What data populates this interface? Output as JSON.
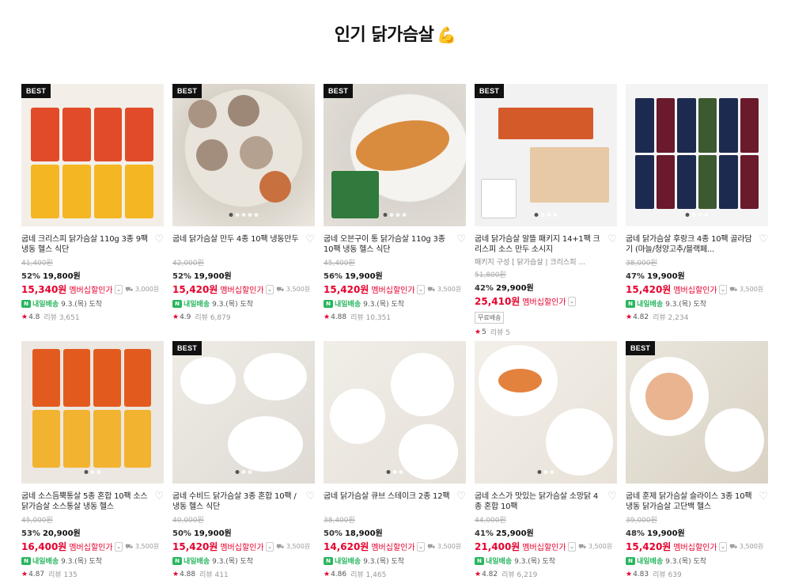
{
  "section": {
    "title": "인기 닭가슴살",
    "emoji": "💪"
  },
  "products": [
    {
      "best": true,
      "name": "굽네 크리스피 닭가슴살 110g 3종 9팩 냉동 헬스 식단",
      "orig": "41,400원",
      "pct": "52%",
      "price": "19,800원",
      "member_price": "15,340원",
      "member_label": "멤버십할인가",
      "ship": "3,000원",
      "delivery": "내일배송",
      "date": "9.3.(목) 도착",
      "rating": "4.8",
      "reviews": "리뷰 3,651",
      "dots": 0
    },
    {
      "best": true,
      "name": "굽네 닭가슴살 만두 4종 10팩 냉동만두",
      "orig": "42,000원",
      "pct": "52%",
      "price": "19,900원",
      "member_price": "15,420원",
      "member_label": "멤버십할인가",
      "ship": "3,500원",
      "delivery": "내일배송",
      "date": "9.3.(목) 도착",
      "rating": "4.9",
      "reviews": "리뷰 6,879",
      "dots": 5
    },
    {
      "best": true,
      "name": "굽네 오븐구이 통 닭가슴살 110g 3종 10팩 냉동 헬스 식단",
      "orig": "45,400원",
      "pct": "56%",
      "price": "19,900원",
      "member_price": "15,420원",
      "member_label": "멤버십할인가",
      "ship": "3,500원",
      "delivery": "내일배송",
      "date": "9.3.(목) 도착",
      "rating": "4.88",
      "reviews": "리뷰 10,351",
      "dots": 4
    },
    {
      "best": true,
      "name": "굽네 닭가슴살 알뜰 패키지 14+1팩 크리스피 소스 만두 소시지",
      "sub": "패키지 구성 [ 닭가슴살 | 크리스피 ...",
      "orig": "51,800원",
      "pct": "42%",
      "price": "29,900원",
      "member_price": "25,410원",
      "member_label": "멤버십할인가",
      "ship": "",
      "delivery": "",
      "date": "",
      "free": "무료배송",
      "rating": "5",
      "reviews": "리뷰 5",
      "dots": 4
    },
    {
      "best": false,
      "name": "굽네 닭가슴살 후랑크 4종 10팩 골라담기 (마늘/청양고추/블랙페...",
      "orig": "38,000원",
      "pct": "47%",
      "price": "19,900원",
      "member_price": "15,420원",
      "member_label": "멤버십할인가",
      "ship": "3,500원",
      "delivery": "내일배송",
      "date": "9.3.(목) 도착",
      "rating": "4.82",
      "reviews": "리뷰 2,234",
      "dots": 4
    },
    {
      "best": false,
      "name": "굽네 소스듬뿍통살 5종 혼합 10팩 소스닭가슴살 소스통살 냉동 헬스",
      "orig": "45,000원",
      "pct": "53%",
      "price": "20,900원",
      "member_price": "16,400원",
      "member_label": "멤버십할인가",
      "ship": "3,500원",
      "delivery": "내일배송",
      "date": "9.3.(목) 도착",
      "rating": "4.87",
      "reviews": "리뷰 135",
      "dots": 3
    },
    {
      "best": true,
      "name": "굽네 수비드 닭가슴살 3종 혼합 10팩 / 냉동 헬스 식단",
      "orig": "40,000원",
      "pct": "50%",
      "price": "19,900원",
      "member_price": "15,420원",
      "member_label": "멤버십할인가",
      "ship": "3,500원",
      "delivery": "내일배송",
      "date": "9.3.(목) 도착",
      "rating": "4.88",
      "reviews": "리뷰 411",
      "dots": 3
    },
    {
      "best": false,
      "name": "굽네 닭가슴살 큐브 스테이크 2종 12팩",
      "orig": "38,400원",
      "pct": "50%",
      "price": "18,900원",
      "member_price": "14,620원",
      "member_label": "멤버십할인가",
      "ship": "3,500원",
      "delivery": "내일배송",
      "date": "9.3.(목) 도착",
      "rating": "4.86",
      "reviews": "리뷰 1,465",
      "dots": 3
    },
    {
      "best": false,
      "name": "굽네 소스가 맛있는 닭가슴살 소망닭 4종 혼합 10팩",
      "orig": "44,000원",
      "pct": "41%",
      "price": "25,900원",
      "member_price": "21,400원",
      "member_label": "멤버십할인가",
      "ship": "3,500원",
      "delivery": "내일배송",
      "date": "9.3.(목) 도착",
      "rating": "4.82",
      "reviews": "리뷰 6,219",
      "dots": 3
    },
    {
      "best": true,
      "name": "굽네 훈제 닭가슴살 슬라이스 3종 10팩 냉동 닭가슴살 고단백 헬스",
      "orig": "39,000원",
      "pct": "48%",
      "price": "19,900원",
      "member_price": "15,420원",
      "member_label": "멤버십할인가",
      "ship": "3,500원",
      "delivery": "내일배송",
      "date": "9.3.(목) 도착",
      "rating": "4.83",
      "reviews": "리뷰 639",
      "dots": 0
    }
  ],
  "colors": {
    "accent": "#e6002d",
    "delivery": "#29b65f"
  },
  "icons": {
    "wish": "heart-icon",
    "star": "star-icon",
    "delivery": "delivery-badge-icon",
    "ship": "shipping-fee-icon"
  }
}
